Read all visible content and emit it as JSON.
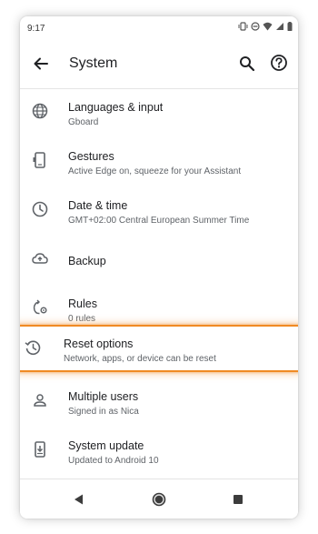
{
  "status_bar": {
    "time": "9:17",
    "icons": [
      "vibrate-icon",
      "do-not-disturb-icon",
      "wifi-icon",
      "signal-icon",
      "battery-icon"
    ]
  },
  "app_bar": {
    "title": "System",
    "icons": [
      "back-arrow-icon",
      "search-icon",
      "help-icon"
    ]
  },
  "items": [
    {
      "title": "Languages & input",
      "subtitle": "Gboard",
      "icon": "globe-icon"
    },
    {
      "title": "Gestures",
      "subtitle": "Active Edge on, squeeze for your Assistant",
      "icon": "gestures-phone-icon"
    },
    {
      "title": "Date & time",
      "subtitle": "GMT+02:00 Central European Summer Time",
      "icon": "clock-icon"
    },
    {
      "title": "Backup",
      "subtitle": "",
      "icon": "cloud-upload-icon"
    },
    {
      "title": "Rules",
      "subtitle": "0 rules",
      "icon": "rules-icon"
    },
    {
      "title": "Reset options",
      "subtitle": "Network, apps, or device can be reset",
      "icon": "history-icon",
      "highlighted": true
    },
    {
      "title": "Multiple users",
      "subtitle": "Signed in as Nica",
      "icon": "person-icon"
    },
    {
      "title": "System update",
      "subtitle": "Updated to Android 10",
      "icon": "system-update-icon"
    }
  ],
  "highlight_color": "#f08a24",
  "nav_bar": {
    "icons": [
      "back-triangle-icon",
      "home-circle-icon",
      "recents-square-icon"
    ]
  }
}
